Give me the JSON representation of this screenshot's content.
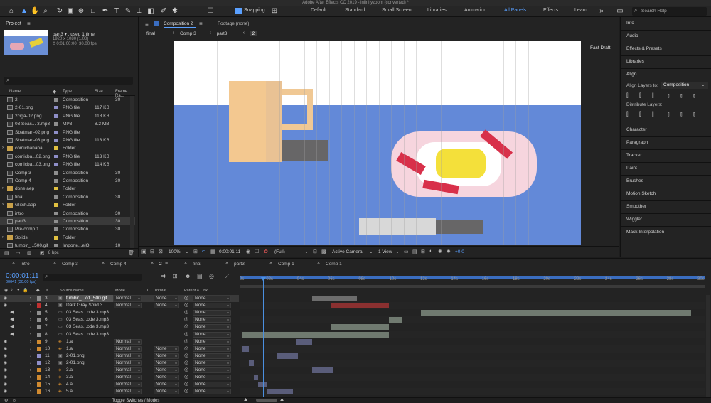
{
  "window_title": "Adobe After Effects CC 2019 - infinityzoom (converted) *",
  "toolbar": {
    "snapping_label": "Snapping",
    "workspaces": [
      "Default",
      "Standard",
      "Small Screen",
      "Libraries",
      "Animation",
      "All Panels",
      "Effects",
      "Learn"
    ],
    "active_workspace": "All Panels",
    "search_placeholder": "Search Help"
  },
  "project": {
    "tab_label": "Project",
    "selected_name": "part3 ▾ , used 1 time",
    "selected_info1": "1920 x 1080 (1.00)",
    "selected_info2": "Δ 0:01:00:00, 30.00 fps",
    "columns": [
      "Name",
      "Type",
      "Size",
      "Frame Ra..."
    ],
    "files": [
      {
        "name": "2",
        "type": "Composition",
        "size": "",
        "fps": "30",
        "color": "#8f8f8f",
        "kind": "comp"
      },
      {
        "name": "2-01.png",
        "type": "PNG file",
        "size": "117 KB",
        "fps": "",
        "color": "#8f8fc8",
        "kind": "file"
      },
      {
        "name": "2ciga-02.png",
        "type": "PNG file",
        "size": "118 KB",
        "fps": "",
        "color": "#8f8fc8",
        "kind": "file"
      },
      {
        "name": "03 Seas... 3.mp3",
        "type": "MP3",
        "size": "8.2 MB",
        "fps": "",
        "color": "#8f8f8f",
        "kind": "file"
      },
      {
        "name": "Sbatman-02.png",
        "type": "PNG file",
        "size": "",
        "fps": "",
        "color": "#8f8fc8",
        "kind": "file"
      },
      {
        "name": "Sbatman-03.png",
        "type": "PNG file",
        "size": "113 KB",
        "fps": "",
        "color": "#8f8fc8",
        "kind": "file"
      },
      {
        "name": "comicbanana",
        "type": "Folder",
        "size": "",
        "fps": "",
        "color": "#e0c040",
        "kind": "folder"
      },
      {
        "name": "comicba...02.png",
        "type": "PNG file",
        "size": "113 KB",
        "fps": "",
        "color": "#8f8fc8",
        "kind": "file"
      },
      {
        "name": "comicba...03.png",
        "type": "PNG file",
        "size": "114 KB",
        "fps": "",
        "color": "#8f8fc8",
        "kind": "file"
      },
      {
        "name": "Comp 3",
        "type": "Composition",
        "size": "",
        "fps": "30",
        "color": "#8f8f8f",
        "kind": "comp"
      },
      {
        "name": "Comp 4",
        "type": "Composition",
        "size": "",
        "fps": "30",
        "color": "#8f8f8f",
        "kind": "comp"
      },
      {
        "name": "done.aep",
        "type": "Folder",
        "size": "",
        "fps": "",
        "color": "#e0c040",
        "kind": "folder"
      },
      {
        "name": "final",
        "type": "Composition",
        "size": "",
        "fps": "30",
        "color": "#8f8f8f",
        "kind": "comp"
      },
      {
        "name": "Glitch.aep",
        "type": "Folder",
        "size": "",
        "fps": "",
        "color": "#e0c040",
        "kind": "folder"
      },
      {
        "name": "intro",
        "type": "Composition",
        "size": "",
        "fps": "30",
        "color": "#8f8f8f",
        "kind": "comp"
      },
      {
        "name": "part3",
        "type": "Composition",
        "size": "",
        "fps": "30",
        "color": "#8f8f8f",
        "kind": "comp"
      },
      {
        "name": "Pre-comp 1",
        "type": "Composition",
        "size": "",
        "fps": "30",
        "color": "#8f8f8f",
        "kind": "comp"
      },
      {
        "name": "Solids",
        "type": "Folder",
        "size": "",
        "fps": "",
        "color": "#e0c040",
        "kind": "folder"
      },
      {
        "name": "tumblr_...500.gif",
        "type": "Importe...elO",
        "size": "",
        "fps": "10",
        "color": "#8f8f8f",
        "kind": "file"
      }
    ],
    "bpc_label": "8 bpc"
  },
  "viewer": {
    "comp_tab": "Composition 2",
    "footage_tab": "Footage (none)",
    "breadcrumbs": [
      "final",
      "Comp 3",
      "part3",
      "2"
    ],
    "fast_draft": "Fast Draft",
    "zoom": "100%",
    "timecode": "0:00:01:11",
    "resolution": "(Full)",
    "camera": "Active Camera",
    "views": "1 View",
    "exposure": "+0.0"
  },
  "right_panel": {
    "items_top": [
      "Info",
      "Audio",
      "Effects & Presets",
      "Libraries"
    ],
    "align_title": "Align",
    "align_layers_to_label": "Align Layers to:",
    "align_layers_to_value": "Composition",
    "distribute_label": "Distribute Layers:",
    "items_bottom": [
      "Character",
      "Paragraph",
      "Tracker",
      "Paint",
      "Brushes",
      "Motion Sketch",
      "Smoother",
      "Wiggler",
      "Mask Interpolation"
    ]
  },
  "timeline": {
    "tabs": [
      "intro",
      "Comp 3",
      "Comp 4",
      "2",
      "final",
      "part3",
      "Comp 1",
      "Comp 1"
    ],
    "active_tab": "2",
    "timecode": "0:00:01:11",
    "frame_info": "00041 (30.00 fps)",
    "col_headers": {
      "num": "#",
      "source": "Source Name",
      "mode": "Mode",
      "t": "T",
      "trkmat": "TrkMat",
      "parent": "Parent & Link"
    },
    "ruler": [
      "0s",
      "02s",
      "04s",
      "06s",
      "08s",
      "10s",
      "12s",
      "14s",
      "16s",
      "18s",
      "20s",
      "22s",
      "24s",
      "26s",
      "28s",
      "30s"
    ],
    "toggle_label": "Toggle Switches / Modes",
    "layers": [
      {
        "num": "3",
        "name": "tumblr_...o1_500.gif",
        "mode": "Normal",
        "trkmat": "None",
        "parent": "None",
        "label": "#8f8f8f",
        "start": 0.155,
        "end": 0.252,
        "bar": "#6c6c6c",
        "selected": true,
        "audio": false
      },
      {
        "num": "4",
        "name": "Dark Gray Solid 3",
        "mode": "Normal",
        "trkmat": "None",
        "parent": "None",
        "label": "#c03030",
        "start": 0.195,
        "end": 0.32,
        "bar": "#8a3030",
        "selected": false,
        "audio": false
      },
      {
        "num": "5",
        "name": "03 Seas...ode 3.mp3",
        "mode": "",
        "trkmat": "",
        "parent": "None",
        "label": "#8f8f8f",
        "start": 0.39,
        "end": 0.97,
        "bar": "#707a70",
        "selected": false,
        "audio": true
      },
      {
        "num": "6",
        "name": "03 Seas...ode 3.mp3",
        "mode": "",
        "trkmat": "",
        "parent": "None",
        "label": "#8f8f8f",
        "start": 0.32,
        "end": 0.35,
        "bar": "#707a70",
        "selected": false,
        "audio": true
      },
      {
        "num": "7",
        "name": "03 Seas...ode 3.mp3",
        "mode": "",
        "trkmat": "",
        "parent": "None",
        "label": "#8f8f8f",
        "start": 0.195,
        "end": 0.32,
        "bar": "#707a70",
        "selected": false,
        "audio": true
      },
      {
        "num": "8",
        "name": "03 Seas...ode 3.mp3",
        "mode": "",
        "trkmat": "",
        "parent": "None",
        "label": "#8f8f8f",
        "start": 0.005,
        "end": 0.32,
        "bar": "#707a70",
        "selected": false,
        "audio": true
      },
      {
        "num": "9",
        "name": "1.ai",
        "mode": "Normal",
        "trkmat": "",
        "parent": "None",
        "label": "#d08a30",
        "start": 0.12,
        "end": 0.155,
        "bar": "#5a5d7a",
        "selected": false,
        "audio": false
      },
      {
        "num": "10",
        "name": "1.ai",
        "mode": "Normal",
        "trkmat": "None",
        "parent": "None",
        "label": "#d08a30",
        "start": 0.005,
        "end": 0.02,
        "bar": "#5a5d7a",
        "selected": false,
        "audio": false
      },
      {
        "num": "11",
        "name": "2-01.png",
        "mode": "Normal",
        "trkmat": "None",
        "parent": "None",
        "label": "#8f8fc8",
        "start": 0.08,
        "end": 0.125,
        "bar": "#5a5d7a",
        "selected": false,
        "audio": false
      },
      {
        "num": "12",
        "name": "2-01.png",
        "mode": "Normal",
        "trkmat": "None",
        "parent": "None",
        "label": "#8f8fc8",
        "start": 0.02,
        "end": 0.03,
        "bar": "#5a5d7a",
        "selected": false,
        "audio": false
      },
      {
        "num": "13",
        "name": "3.ai",
        "mode": "Normal",
        "trkmat": "None",
        "parent": "None",
        "label": "#d08a30",
        "start": 0.155,
        "end": 0.2,
        "bar": "#5a5d7a",
        "selected": false,
        "audio": false
      },
      {
        "num": "14",
        "name": "3.ai",
        "mode": "Normal",
        "trkmat": "None",
        "parent": "None",
        "label": "#d08a30",
        "start": 0.03,
        "end": 0.04,
        "bar": "#5a5d7a",
        "selected": false,
        "audio": false
      },
      {
        "num": "15",
        "name": "4.ai",
        "mode": "Normal",
        "trkmat": "None",
        "parent": "None",
        "label": "#d08a30",
        "start": 0.04,
        "end": 0.06,
        "bar": "#5a5d7a",
        "selected": false,
        "audio": false
      },
      {
        "num": "16",
        "name": "5.ai",
        "mode": "Normal",
        "trkmat": "None",
        "parent": "None",
        "label": "#d08a30",
        "start": 0.06,
        "end": 0.115,
        "bar": "#5a5d7a",
        "selected": false,
        "audio": false
      }
    ]
  },
  "colors": {
    "accent": "#2d8ceb",
    "playhead": "#4a8fe0",
    "canvas_blue": "#6389d8"
  }
}
